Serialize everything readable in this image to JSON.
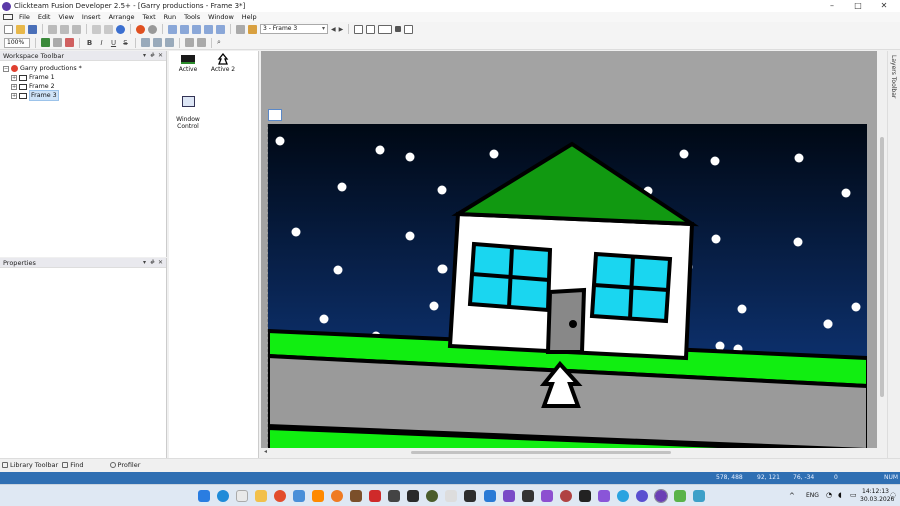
{
  "window": {
    "title": "Clickteam Fusion Developer 2.5+ - [Garry productions - Frame 3*]",
    "minimize": "–",
    "maximize": "□",
    "close": "✕"
  },
  "menu": [
    "File",
    "Edit",
    "View",
    "Insert",
    "Arrange",
    "Text",
    "Run",
    "Tools",
    "Window",
    "Help"
  ],
  "toolbar": {
    "frame_select_value": "3 - Frame 3",
    "zoom_value": "100%",
    "bold": "B",
    "italic": "I",
    "underline": "U",
    "strike": "S"
  },
  "workspace": {
    "header": "Workspace Toolbar",
    "header_controls": [
      "▾",
      "#",
      "✕"
    ],
    "tree": [
      {
        "label": "Garry productions *",
        "expand": "−"
      },
      {
        "label": "Frame 1",
        "expand": "+"
      },
      {
        "label": "Frame 2",
        "expand": "+"
      },
      {
        "label": "Frame 3",
        "expand": "+"
      }
    ]
  },
  "properties": {
    "header": "Properties",
    "header_controls": [
      "▾",
      "#",
      "✕"
    ]
  },
  "objects": [
    {
      "label": "Active"
    },
    {
      "label": "Active 2"
    },
    {
      "label": "Window\nControl"
    }
  ],
  "layers_toolbar": "Layers Toolbar",
  "bottom_tabs": [
    "Library Toolbar",
    "Find",
    "Profiler"
  ],
  "status": {
    "pos1": "578, 488",
    "pos2": "92, 121",
    "pos3": "76, -34",
    "layer": "0",
    "num": "NUM"
  },
  "tray": {
    "lang": "ENG",
    "time": "14:12:13",
    "date": "30.03.2026"
  },
  "colors": {
    "sky_top": "#000814",
    "sky_bottom": "#12408f",
    "grass": "#11ee11",
    "road": "#9a9a9a",
    "roof": "#119911",
    "window": "#1ad6f0",
    "door": "#888888",
    "status_bar": "#2f6fb3"
  }
}
